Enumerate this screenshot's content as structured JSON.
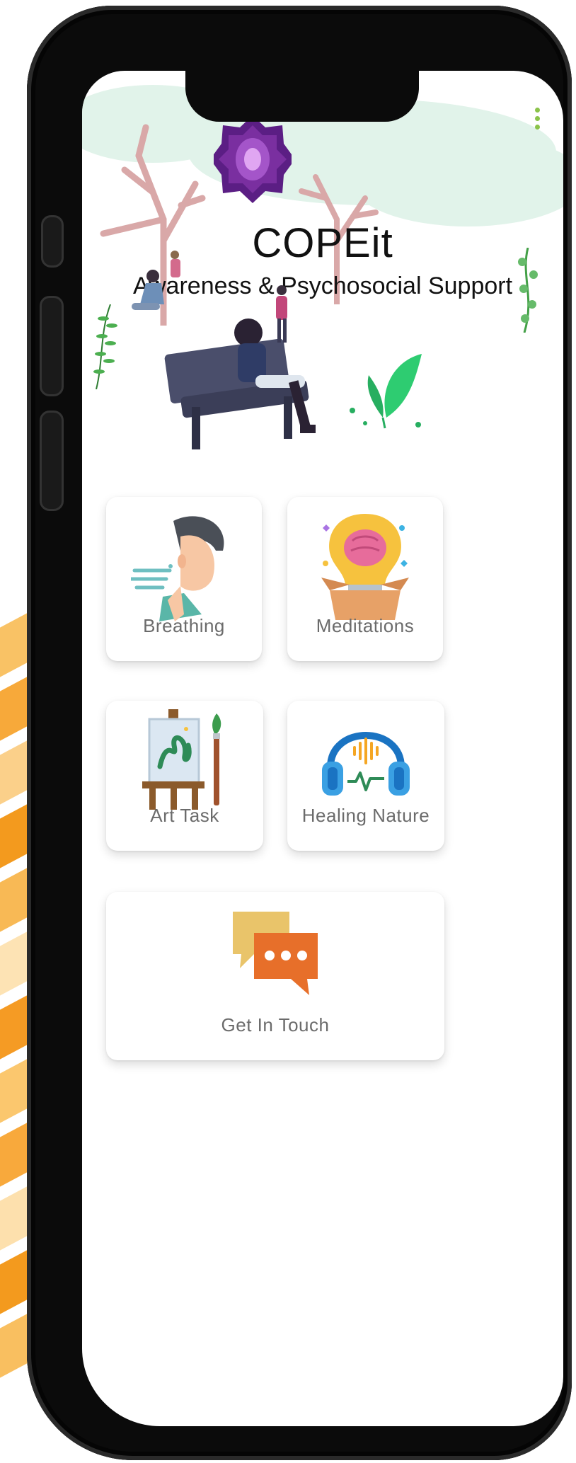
{
  "app": {
    "title": "COPEit",
    "subtitle": "Awareness & Psychosocial Support"
  },
  "menu": {
    "icon": "more-vert-icon"
  },
  "cards": [
    {
      "label": "Breathing",
      "icon": "breathing-person-icon"
    },
    {
      "label": "Meditations",
      "icon": "brain-lightbulb-icon"
    },
    {
      "label": "Art Task",
      "icon": "easel-painting-icon"
    },
    {
      "label": "Healing Nature",
      "icon": "headphones-sound-icon"
    },
    {
      "label": "Get In Touch",
      "icon": "chat-bubbles-icon"
    }
  ],
  "colors": {
    "logo_purple": "#7a2fa0",
    "menu_green": "#8bc34a",
    "card_label": "#6b6b6b",
    "accent_orange": "#f5a623"
  }
}
